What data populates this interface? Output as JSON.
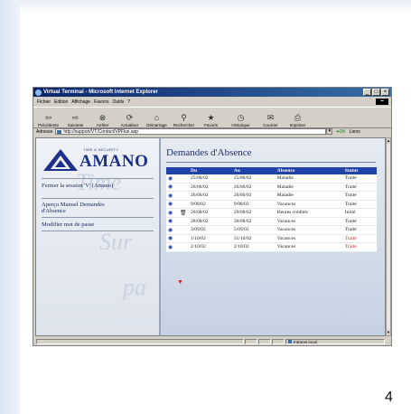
{
  "slide": {
    "number": "4"
  },
  "browser": {
    "title": "Virtual Terminal - Microsoft Internet Explorer",
    "menu": [
      "Fichier",
      "Edition",
      "Affichage",
      "Favoris",
      "Outils",
      "?"
    ],
    "toolbar": [
      {
        "label": "Précédente",
        "icon": "back-arrow-icon"
      },
      {
        "label": "Suivante",
        "icon": "forward-arrow-icon"
      },
      {
        "label": "Arrêter",
        "icon": "stop-icon"
      },
      {
        "label": "Actualiser",
        "icon": "refresh-icon"
      },
      {
        "label": "Démarrage",
        "icon": "home-icon"
      },
      {
        "label": "Rechercher",
        "icon": "search-icon"
      },
      {
        "label": "Favoris",
        "icon": "favorites-icon"
      },
      {
        "label": "Historique",
        "icon": "history-icon"
      },
      {
        "label": "Courrier",
        "icon": "mail-icon"
      },
      {
        "label": "Imprimer",
        "icon": "print-icon"
      }
    ],
    "address_label": "Adresse",
    "address_value": "http://support/VT/Contact/VPFlux.asp",
    "go_label": "OK",
    "links_label": "Liens",
    "status_zone": "Intranet local"
  },
  "sidebar": {
    "logo_tag": "TIME & SECURITY",
    "logo_name": "AMANO",
    "links": [
      "Fermer la session 'V' (Amano)",
      "Aperçu Manuel Demandes d'Absence",
      "Modifier mot de passe"
    ],
    "watermark": [
      "Time",
      "Sur",
      "pa"
    ]
  },
  "main": {
    "title": "Demandes d'Absence",
    "columns": [
      "Du",
      "Au",
      "Absence",
      "Statut"
    ],
    "rows": [
      {
        "du": "25/06/02",
        "au": "25/06/02",
        "absence": "Maladie",
        "statut": "Traité",
        "red": false,
        "trash": false
      },
      {
        "du": "26/06/02",
        "au": "26/06/02",
        "absence": "Maladie",
        "statut": "Traité",
        "red": false,
        "trash": false
      },
      {
        "du": "26/06/02",
        "au": "26/06/02",
        "absence": "Maladie",
        "statut": "Traité",
        "red": false,
        "trash": false
      },
      {
        "du": "9/08/02",
        "au": "9/08/02",
        "absence": "Vacances",
        "statut": "Traité",
        "red": false,
        "trash": false
      },
      {
        "du": "26/08/02",
        "au": "29/08/02",
        "absence": "Heures crédités",
        "statut": "Initié",
        "red": false,
        "trash": true
      },
      {
        "du": "28/08/02",
        "au": "30/08/02",
        "absence": "Vacances",
        "statut": "Traité",
        "red": false,
        "trash": false
      },
      {
        "du": "3/09/02",
        "au": "5/09/02",
        "absence": "Vacances",
        "statut": "Traité",
        "red": false,
        "trash": false
      },
      {
        "du": "1/10/02",
        "au": "31/10/02",
        "absence": "Vacances",
        "statut": "Traité",
        "red": true,
        "trash": false
      },
      {
        "du": "2/10/02",
        "au": "2/10/02",
        "absence": "Vacances",
        "statut": "Traité",
        "red": true,
        "trash": false
      }
    ]
  },
  "colors": {
    "header_blue": "#2142a8",
    "status_red": "#d42020",
    "logo_blue": "#1c2f8a"
  }
}
